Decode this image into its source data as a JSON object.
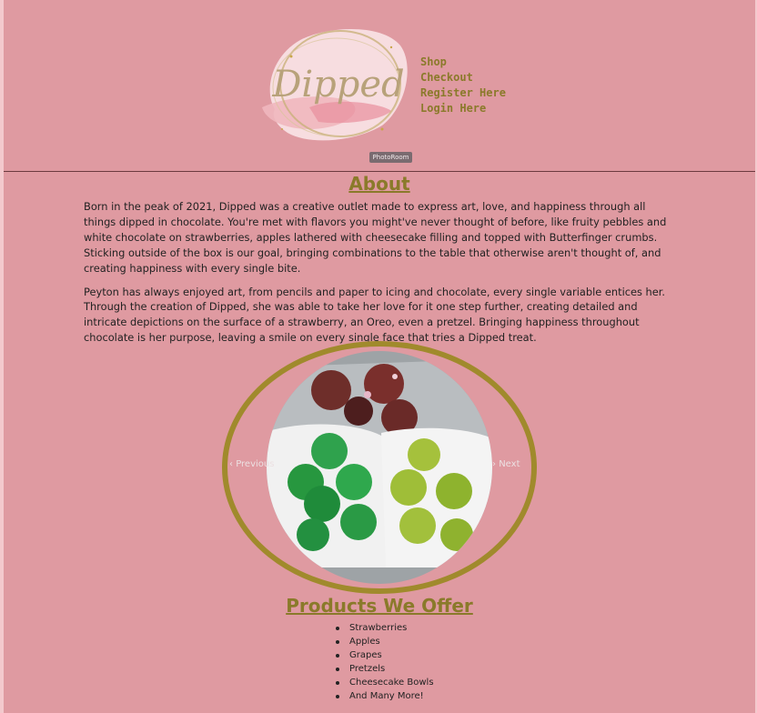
{
  "brand": {
    "logo_text": "Dipped",
    "badge": "PhotoRoom"
  },
  "nav": [
    {
      "label": "Shop"
    },
    {
      "label": "Checkout"
    },
    {
      "label": "Register Here"
    },
    {
      "label": "Login Here"
    }
  ],
  "about": {
    "title": "About",
    "paragraphs": [
      "Born in the peak of 2021, Dipped was a creative outlet made to express art, love, and happiness through all things dipped in chocolate. You're met with flavors you might've never thought of before, like fruity pebbles and white chocolate on strawberries, apples lathered with cheesecake filling and topped with Butterfinger crumbs. Sticking outside of the box is our goal, bringing combinations to the table that otherwise aren't thought of, and creating happiness with every single bite.",
      "Peyton has always enjoyed art, from pencils and paper to icing and chocolate, every single variable entices her. Through the creation of Dipped, she was able to take her love for it one step further, creating detailed and intricate depictions on the surface of a strawberry, an Oreo, even a pretzel. Bringing happiness throughout chocolate is her purpose, leaving a smile on every single face that tries a Dipped treat."
    ]
  },
  "carousel": {
    "prev_label": "Previous",
    "next_label": "Next"
  },
  "products": {
    "title": "Products We Offer",
    "items": [
      "Strawberries",
      "Apples",
      "Grapes",
      "Pretzels",
      "Cheesecake Bowls",
      "And Many More!"
    ]
  },
  "colors": {
    "background": "#df9aa1",
    "accent": "#8a7a2a",
    "ring": "#a08a2c"
  }
}
